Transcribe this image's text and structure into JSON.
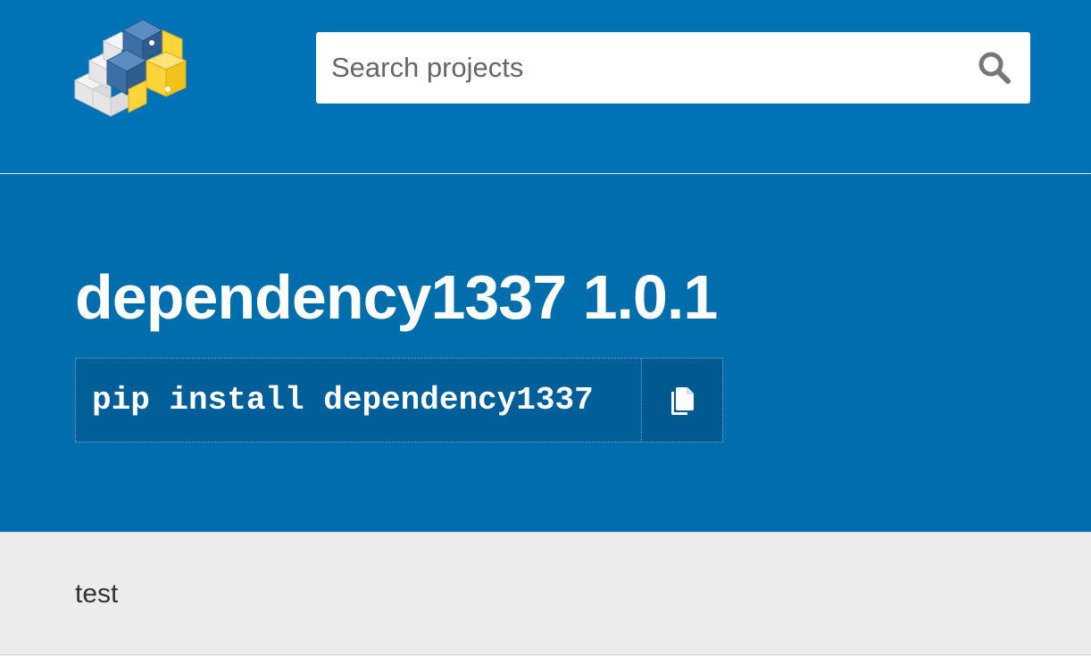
{
  "header": {
    "logo_icon": "pypi-logo-icon",
    "search": {
      "placeholder": "Search projects",
      "value": "",
      "icon": "search-icon"
    }
  },
  "package": {
    "name": "dependency1337",
    "version": "1.0.1",
    "title": "dependency1337 1.0.1",
    "pip_command": "pip install dependency1337",
    "copy_icon": "copy-icon"
  },
  "summary": {
    "text": "test"
  },
  "colors": {
    "header_bg": "#0073b7",
    "banner_bg": "#006dad",
    "pip_bg": "#005f98",
    "summary_bg": "#ececec",
    "logo_blue": "#3c6fa6",
    "logo_yellow": "#ffd43b"
  }
}
